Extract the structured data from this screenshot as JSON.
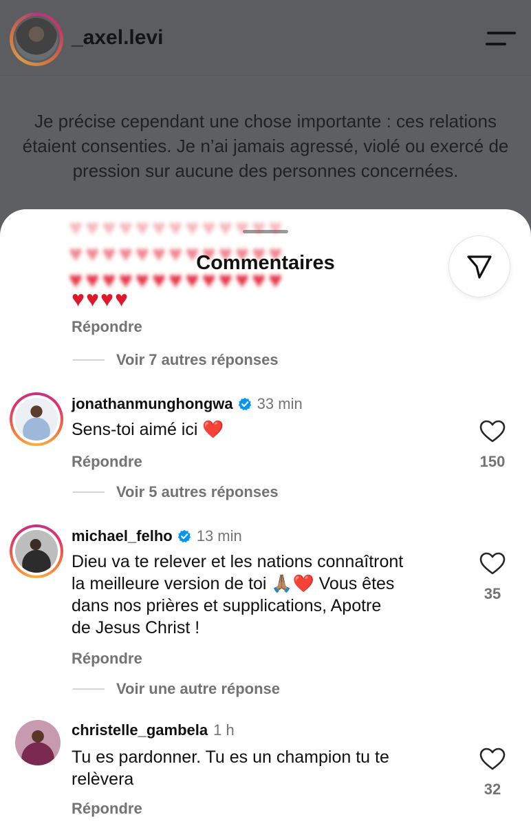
{
  "post": {
    "username": "_axel.levi",
    "text": "Je précise cependant une chose importante : ces relations étaient consenties. Je n’ai jamais agressé, violé ou exercé de pression sur aucune des personnes concernées."
  },
  "sheet": {
    "title": "Commentaires",
    "first_comment": {
      "reply_label": "Répondre",
      "more_replies": "Voir 7 autres réponses"
    }
  },
  "comments": [
    {
      "username": "jonathanmunghongwa",
      "verified": true,
      "time": "33 min",
      "text": "Sens-toi aimé ici ",
      "emoji": "❤️",
      "likes": "150",
      "reply_label": "Répondre",
      "more_replies": "Voir 5 autres réponses"
    },
    {
      "username": "michael_felho",
      "verified": true,
      "time": "13 min",
      "text_lines": [
        "Dieu va te relever et les nations connaîtront",
        "la meilleure version de toi 🙏🏽❤️ Vous êtes",
        "dans nos prières et supplications, Apotre",
        "de Jesus Christ !"
      ],
      "likes": "35",
      "reply_label": "Répondre",
      "more_replies": "Voir une autre réponse"
    },
    {
      "username": "christelle_gambela",
      "verified": false,
      "time": "1 h",
      "text_lines": [
        "Tu es pardonner. Tu es un champion tu te",
        "relèvera"
      ],
      "likes": "32",
      "reply_label": "Répondre"
    }
  ],
  "colors": {
    "accent_heart": "#e0162b",
    "verified_blue": "#0095f6",
    "secondary_text": "#737373",
    "dim_overlay": "#5d5f63"
  }
}
